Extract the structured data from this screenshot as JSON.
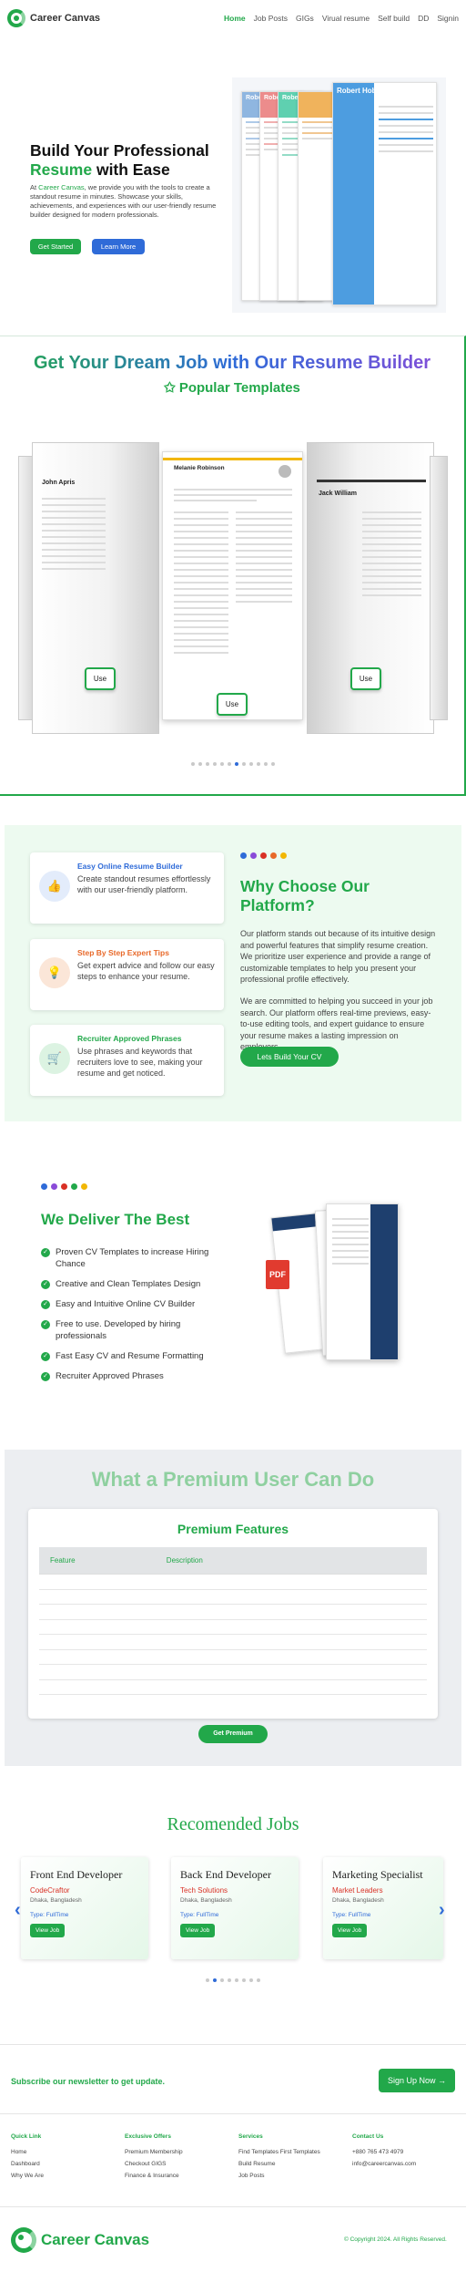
{
  "nav": {
    "brand": "Career Canvas",
    "items": [
      "Home",
      "Job Posts",
      "GIGs",
      "Virual resume",
      "Self build",
      "DD",
      "Signin"
    ]
  },
  "hero": {
    "title_line1": "Build Your Professional",
    "title_green": "Resume",
    "title_rest": " with Ease",
    "text_prefix": "At ",
    "text_brand": "Career Canvas",
    "text_rest": ", we provide you with the tools to create a standout resume in minutes. Showcase your skills, achievements, and experiences with our user-friendly resume builder designed for modern professionals.",
    "btn_start": "Get Started",
    "btn_learn": "Learn More",
    "collage_names": [
      "Robert",
      "Robert",
      "Robert R",
      "Robert Hobs"
    ]
  },
  "templates": {
    "title": "Get Your Dream Job with Our Resume Builder",
    "popular": "✩ Popular Templates",
    "left_name": "John Apris",
    "center_name": "Melanie Robinson",
    "right_name": "Jack William",
    "use_label": "Use",
    "dot_count": 12,
    "active_dot": 6
  },
  "why": {
    "features": [
      {
        "title": "Easy Online Resume Builder",
        "desc": "Create standout resumes effortlessly with our user-friendly platform.",
        "color": "#2f6bd8",
        "icon": "👍"
      },
      {
        "title": "Step By Step Expert Tips",
        "desc": "Get expert advice and follow our easy steps to enhance your resume.",
        "color": "#e8692a",
        "icon": "💡"
      },
      {
        "title": "Recruiter Approved Phrases",
        "desc": "Use phrases and keywords that recruiters love to see, making your resume and get noticed.",
        "color": "#22a84a",
        "icon": "🛒"
      }
    ],
    "dot_colors": [
      "#2f6bd8",
      "#8a4bd8",
      "#d93025",
      "#e8692a",
      "#f2b705"
    ],
    "title": "Why Choose Our Platform?",
    "para1": "Our platform stands out because of its intuitive design and powerful features that simplify resume creation. We prioritize user experience and provide a range of customizable templates to help you present your professional profile effectively.",
    "para2": "We are committed to helping you succeed in your job search. Our platform offers real-time previews, easy-to-use editing tools, and expert guidance to ensure your resume makes a lasting impression on employers.",
    "cta": "Lets Build Your CV"
  },
  "deliver": {
    "dot_colors": [
      "#2f6bd8",
      "#8a4bd8",
      "#d93025",
      "#22a84a",
      "#f2b705"
    ],
    "title": "We Deliver The Best",
    "items": [
      "Proven CV Templates to increase Hiring Chance",
      "Creative and Clean Templates Design",
      "Easy and Intuitive Online CV Builder",
      "Free to use. Developed by hiring professionals",
      "Fast Easy CV and Resume Formatting",
      "Recruiter Approved Phrases"
    ],
    "pdf_label": "PDF"
  },
  "premium": {
    "title": "What a Premium User Can Do",
    "card_title": "Premium Features",
    "col_feature": "Feature",
    "col_desc": "Description",
    "row_count": 8,
    "btn": "Get Premium"
  },
  "jobs": {
    "title": "Recomended Jobs",
    "list": [
      {
        "title": "Front End Developer",
        "company": "CodeCraftor",
        "location": "Dhaka, Bangladesh",
        "type": "Type: FullTime",
        "btn": "View Job"
      },
      {
        "title": "Back End Developer",
        "company": "Tech Solutions",
        "location": "Dhaka, Bangladesh",
        "type": "Type: FullTime",
        "btn": "View Job"
      },
      {
        "title": "Marketing Specialist",
        "company": "Market Leaders",
        "location": "Dhaka, Bangladesh",
        "type": "Type: FullTime",
        "btn": "View Job"
      }
    ],
    "dot_count": 8,
    "active_dot": 1
  },
  "newsletter": {
    "text": "Subscribe our newsletter to get update.",
    "btn": "Sign Up Now →"
  },
  "footer": {
    "cols": [
      {
        "head": "Quick Link",
        "links": [
          "Home",
          "Dashboard",
          "Why We Are"
        ]
      },
      {
        "head": "Exclusive Offers",
        "links": [
          "Premium Membership",
          "Checkout GIGS",
          "Finance & Insurance"
        ]
      },
      {
        "head": "Services",
        "links": [
          "Find Templates First Templates",
          "Build Resume",
          "Job Posts"
        ]
      },
      {
        "head": "Contact Us",
        "links": [
          "+880 765 473 4979",
          "info@careercanvas.com"
        ]
      }
    ],
    "brand": "Career Canvas",
    "copyright": "© Copyright 2024. All Rights Reserved."
  }
}
